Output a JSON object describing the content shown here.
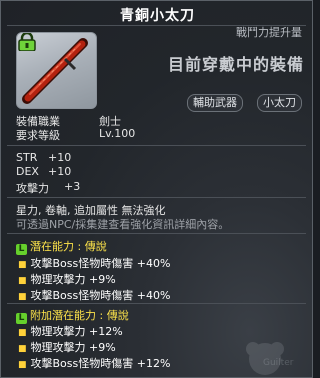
{
  "title": "青銅小太刀",
  "combat_power_label": "戰鬥力提升量",
  "equipped_label": "目前穿戴中的裝備",
  "tags": [
    "輔助武器",
    "小太刀"
  ],
  "requirements": {
    "job_label": "裝備職業",
    "job_value": "劍士",
    "level_label": "要求等級",
    "level_value": "Lv.100"
  },
  "stats": [
    {
      "name": "STR",
      "value": "+10"
    },
    {
      "name": "DEX",
      "value": "+10"
    },
    {
      "name": "攻擊力",
      "value": "+3"
    }
  ],
  "upgrade_text": "星力, 卷軸, 追加屬性 無法強化",
  "npc_text": "可透過NPC/採集建查看強化資訊詳細內容。",
  "potential": {
    "badge": "L",
    "title": "潛在能力 : 傳說",
    "lines": [
      {
        "text": "攻擊Boss怪物時傷害",
        "value": "+40%"
      },
      {
        "text": "物理攻擊力",
        "value": "+9%"
      },
      {
        "text": "攻擊Boss怪物時傷害",
        "value": "+40%"
      }
    ]
  },
  "bonus_potential": {
    "badge": "L",
    "title": "附加潛在能力 : 傳說",
    "lines": [
      {
        "text": "物理攻擊力",
        "value": "+12%"
      },
      {
        "text": "物理攻擊力",
        "value": "+9%"
      },
      {
        "text": "攻擊Boss怪物時傷害",
        "value": "+12%"
      }
    ]
  },
  "watermark_text": "Guilter",
  "colors": {
    "legendary_green": "#66d02c",
    "section_yellow": "#fde34a",
    "bullet_yellow": "#ffd23a"
  }
}
